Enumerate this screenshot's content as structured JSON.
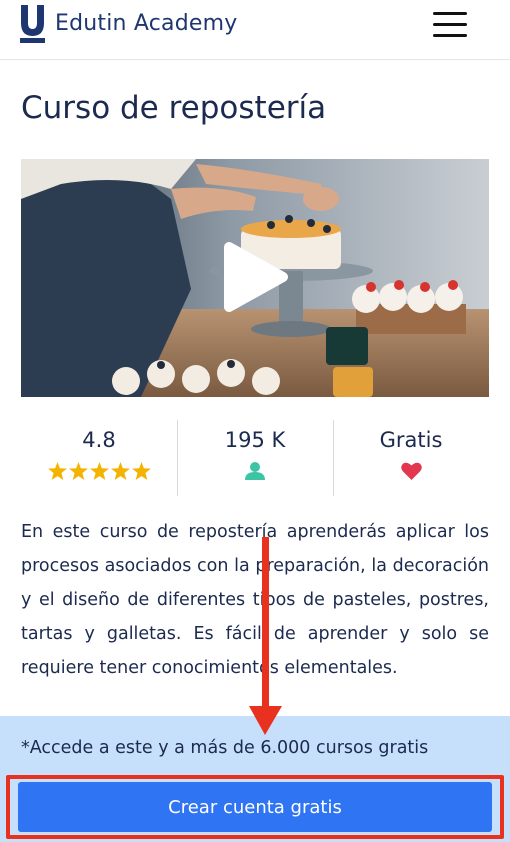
{
  "header": {
    "brand_letter": "U",
    "brand_name": "Edutin Academy",
    "menu_icon": "hamburger-menu-icon"
  },
  "course": {
    "title": "Curso de repostería",
    "video_play_icon": "play-icon"
  },
  "stats": {
    "rating": {
      "value": "4.8",
      "stars": 5,
      "icon": "star-icon"
    },
    "students": {
      "value": "195 K",
      "icon": "user-icon"
    },
    "price": {
      "value": "Gratis",
      "icon": "heart-icon"
    }
  },
  "description": "En este curso de repostería aprenderás aplicar los procesos asociados con la preparación, la decoración y el diseño de diferentes tipos de pasteles, postres, tartas y galletas. Es fácil de aprender y solo se requiere tener conocimientos elementales.",
  "promo": {
    "text": "*Accede a este y a más de 6.000 cursos gratis"
  },
  "cta": {
    "label": "Crear cuenta gratis"
  },
  "colors": {
    "brand": "#1f3770",
    "star": "#f5b301",
    "user_icon": "#3cc4a4",
    "heart": "#e2374f",
    "promo_bg": "#c6e0fb",
    "cta_bg": "#2f74f2",
    "annotation_red": "#e8321f"
  }
}
